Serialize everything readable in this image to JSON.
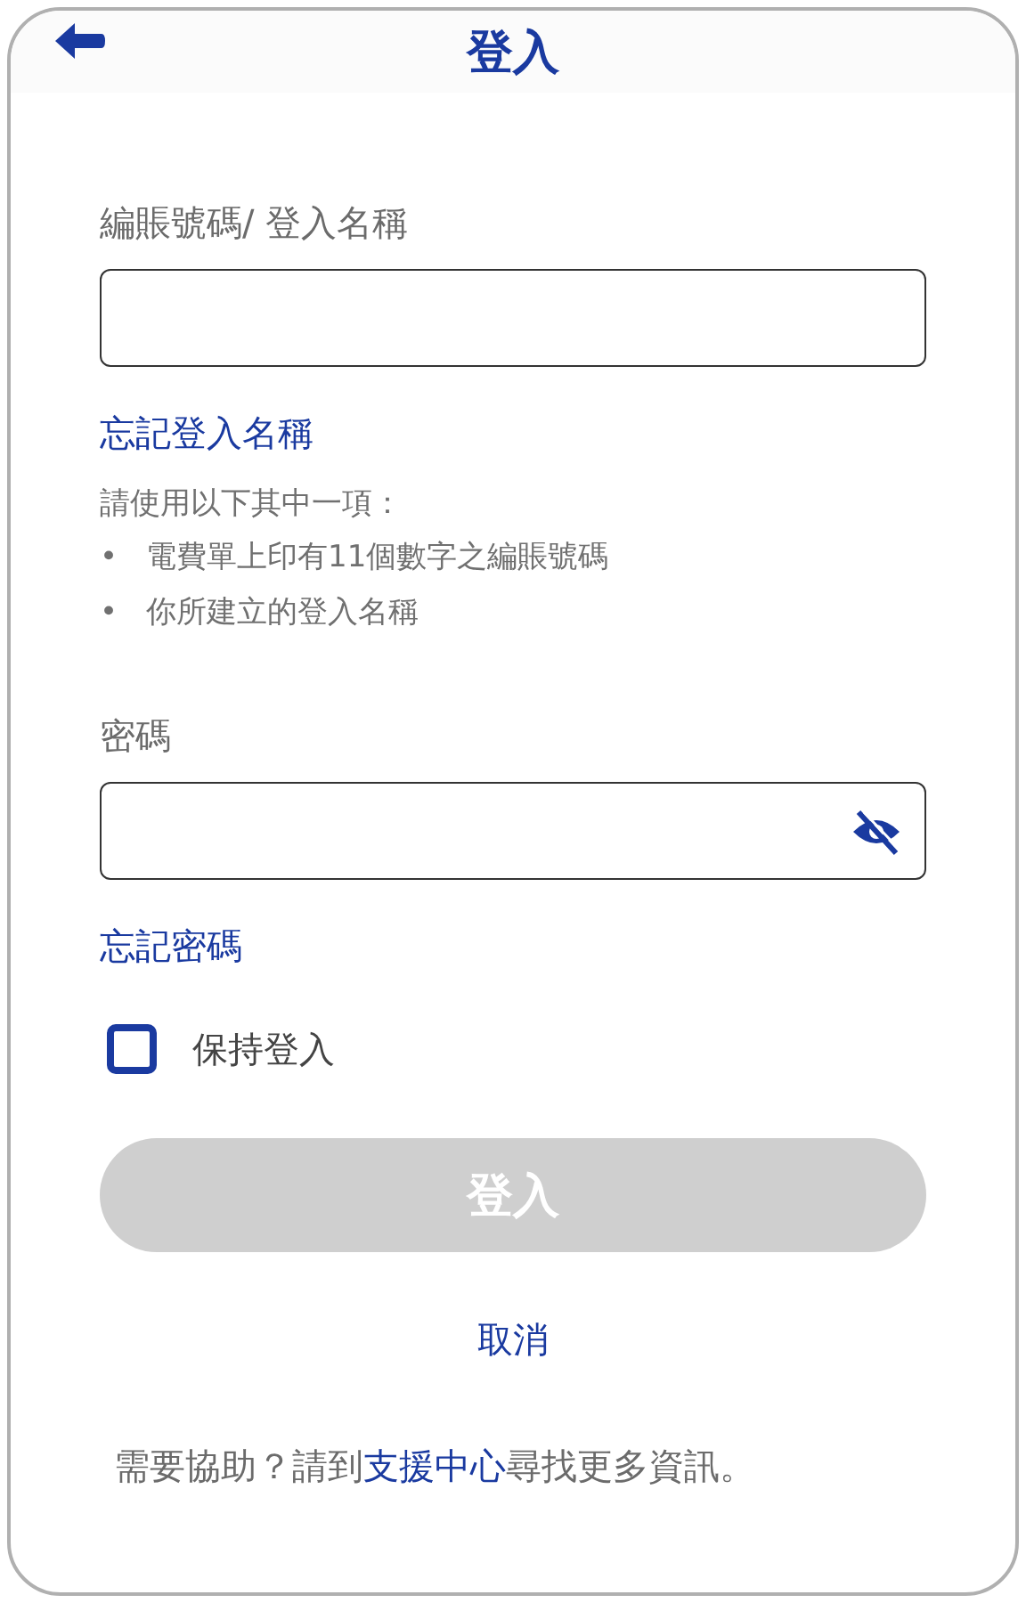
{
  "header": {
    "title": "登入"
  },
  "account": {
    "label": "編賬號碼/ 登入名稱",
    "forgot_link": "忘記登入名稱",
    "hint": "請使用以下其中一項：",
    "options": [
      {
        "marker": "•",
        "text": "電費單上印有11個數字之編賬號碼"
      },
      {
        "marker": "•",
        "text": "你所建立的登入名稱"
      }
    ]
  },
  "password": {
    "label": "密碼",
    "password_visible": false,
    "forgot_link": "忘記密碼"
  },
  "remember": {
    "label": "保持登入",
    "checked": false
  },
  "sign_in_button": {
    "label": "登入",
    "disabled": true
  },
  "cancel_link": "取消",
  "help": {
    "before": "需要協助？請到",
    "link": "支援中心",
    "after": "尋找更多資訊。"
  }
}
